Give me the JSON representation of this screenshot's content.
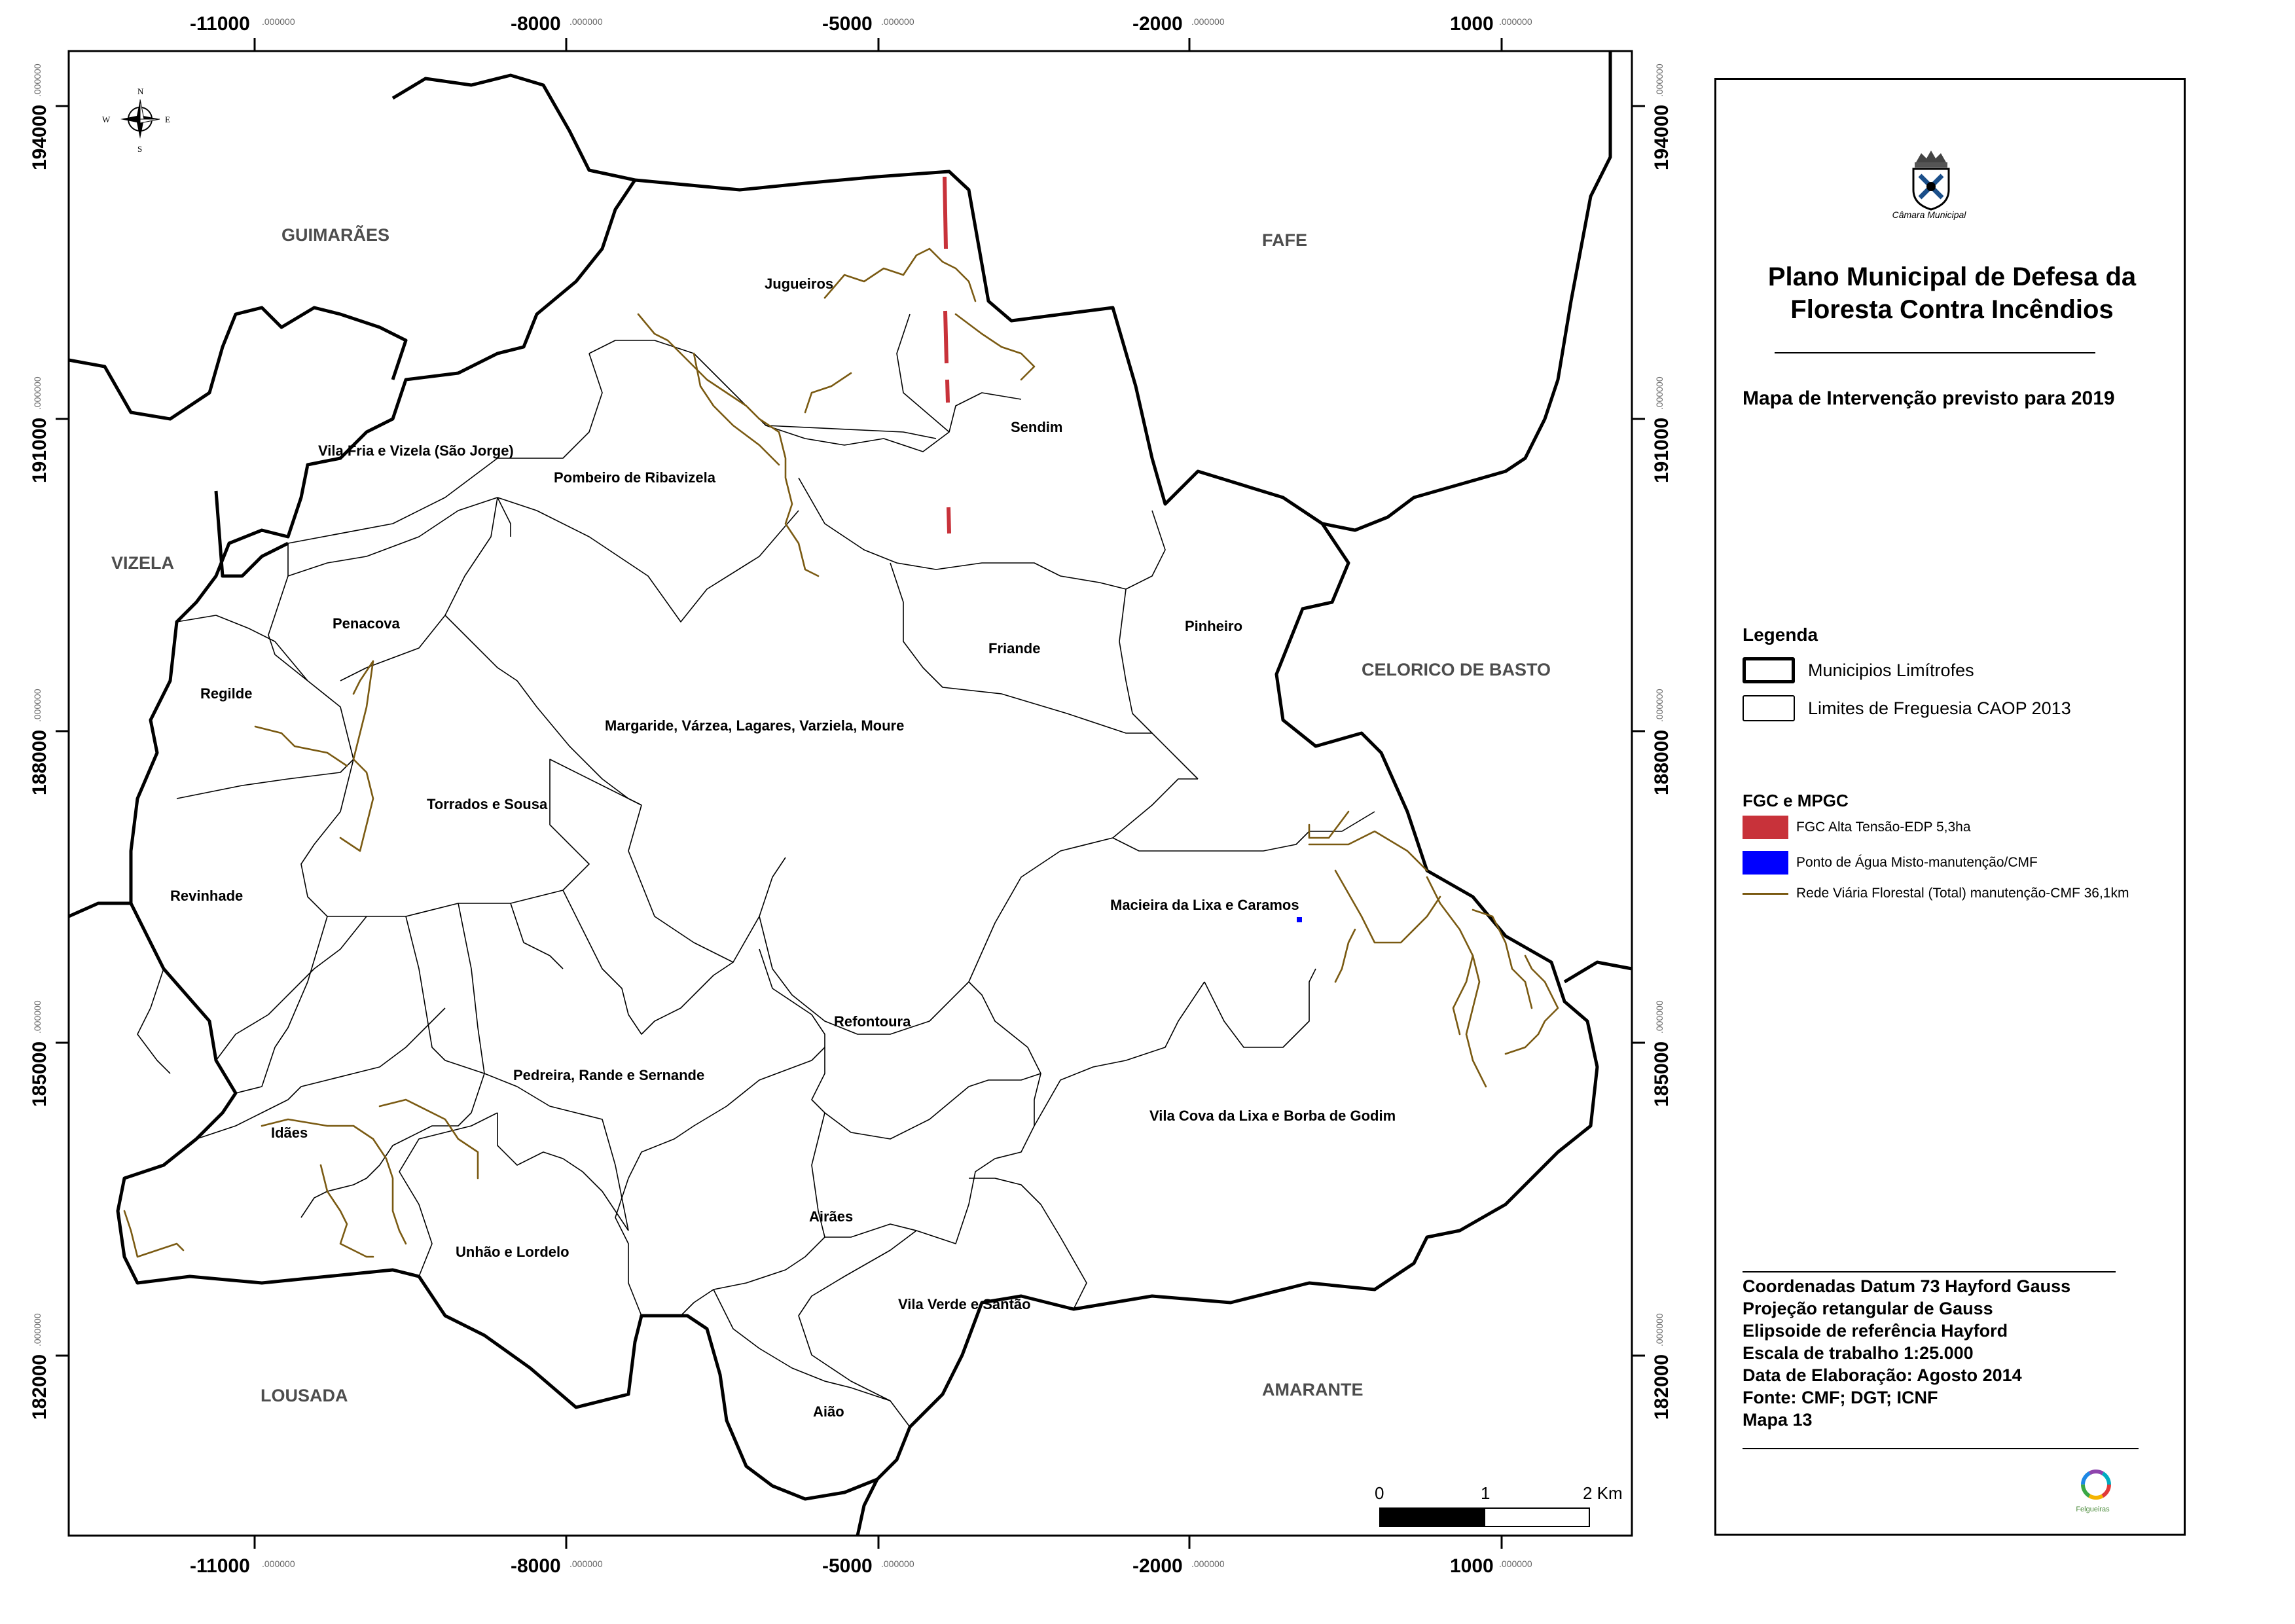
{
  "graticule": {
    "x_ticks": [
      "-11000",
      "-8000",
      "-5000",
      "-2000",
      "1000"
    ],
    "y_ticks": [
      "194000",
      "191000",
      "188000",
      "185000",
      "182000"
    ],
    "decimals": ".000000"
  },
  "municipalities": {
    "guimaraes": "GUIMARÃES",
    "fafe": "FAFE",
    "vizela": "VIZELA",
    "celorico": "CELORICO DE BASTO",
    "lousada": "LOUSADA",
    "amarante": "AMARANTE"
  },
  "parishes": {
    "jugueiros": "Jugueiros",
    "sendim": "Sendim",
    "vila_fria": "Vila Fria e Vizela (São Jorge)",
    "pombeiro": "Pombeiro de Ribavizela",
    "penacova": "Penacova",
    "friande": "Friande",
    "pinheiro": "Pinheiro",
    "regilde": "Regilde",
    "margaride": "Margaride, Várzea, Lagares, Varziela, Moure",
    "torrados": "Torrados e Sousa",
    "revinhade": "Revinhade",
    "macieira": "Macieira da Lixa e Caramos",
    "refontoura": "Refontoura",
    "pedreira": "Pedreira, Rande e Sernande",
    "idaes": "Idães",
    "vila_cova": "Vila Cova da Lixa e Borba de Godim",
    "airaes": "Airães",
    "unhao": "Unhão e Lordelo",
    "vila_verde": "Vila Verde e Santão",
    "aiao": "Aião"
  },
  "compass": {
    "n": "N",
    "s": "S",
    "e": "E",
    "w": "W"
  },
  "scale_bar": {
    "labels": [
      "0",
      "1",
      "2 Km"
    ]
  },
  "panel": {
    "crest_label": "Câmara Municipal",
    "title": "Plano Municipal de Defesa da Floresta Contra Incêndios",
    "subtitle": "Mapa de Intervenção previsto para 2019",
    "legend_title": "Legenda",
    "legend_items": [
      "Municipios Limítrofes",
      "Limites de Freguesia CAOP 2013"
    ],
    "fgc_title": "FGC e MPGC",
    "fgc_items": [
      {
        "label": "FGC Alta Tensão-EDP 5,3ha",
        "color": "#c8323a",
        "kind": "fill"
      },
      {
        "label": "Ponto de Água Misto-manutenção/CMF",
        "color": "#0000ff",
        "kind": "fill"
      },
      {
        "label": "Rede Viária Florestal (Total) manutenção-CMF 36,1km",
        "color": "#7a5a12",
        "kind": "line"
      }
    ],
    "meta": [
      "Coordenadas Datum 73 Hayford Gauss",
      "Projeção retangular de Gauss",
      "Elipsoide de referência Hayford",
      "Escala de trabalho 1:25.000",
      "Data de Elaboração: Agosto 2014",
      "Fonte: CMF; DGT; ICNF",
      "Mapa 13"
    ],
    "logo_label": "Felgueiras"
  }
}
